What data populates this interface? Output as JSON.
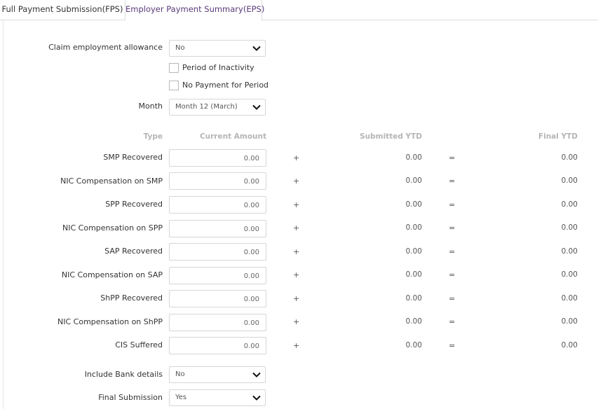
{
  "tabs": [
    {
      "label": "Full Payment Submission(FPS)",
      "active": false
    },
    {
      "label": "Employer Payment Summary(EPS)",
      "active": true
    }
  ],
  "form": {
    "claim_employment_allowance": {
      "label": "Claim employment allowance",
      "value": "No"
    },
    "period_of_inactivity": {
      "label": "Period of Inactivity",
      "checked": false
    },
    "no_payment_for_period": {
      "label": "No Payment for Period",
      "checked": false
    },
    "month": {
      "label": "Month",
      "value": "Month 12 (March)"
    },
    "include_bank_details": {
      "label": "Include Bank details",
      "value": "No"
    },
    "final_submission": {
      "label": "Final Submission",
      "value": "Yes"
    }
  },
  "table": {
    "headers": {
      "type": "Type",
      "current": "Current Amount",
      "submitted": "Submitted YTD",
      "final": "Final YTD"
    },
    "plus": "+",
    "equals": "=",
    "rows": [
      {
        "type": "SMP Recovered",
        "current": "0.00",
        "submitted": "0.00",
        "final": "0.00"
      },
      {
        "type": "NIC Compensation on SMP",
        "current": "0.00",
        "submitted": "0.00",
        "final": "0.00"
      },
      {
        "type": "SPP Recovered",
        "current": "0.00",
        "submitted": "0.00",
        "final": "0.00"
      },
      {
        "type": "NIC Compensation on SPP",
        "current": "0.00",
        "submitted": "0.00",
        "final": "0.00"
      },
      {
        "type": "SAP Recovered",
        "current": "0.00",
        "submitted": "0.00",
        "final": "0.00"
      },
      {
        "type": "NIC Compensation on SAP",
        "current": "0.00",
        "submitted": "0.00",
        "final": "0.00"
      },
      {
        "type": "ShPP Recovered",
        "current": "0.00",
        "submitted": "0.00",
        "final": "0.00"
      },
      {
        "type": "NIC Compensation on ShPP",
        "current": "0.00",
        "submitted": "0.00",
        "final": "0.00"
      },
      {
        "type": "CIS Suffered",
        "current": "0.00",
        "submitted": "0.00",
        "final": "0.00"
      }
    ]
  },
  "colors": {
    "active_tab_text": "#5a3a7a",
    "header_text": "#b5b5b5"
  },
  "icons": {
    "dropdown": "chevron-down-icon"
  }
}
